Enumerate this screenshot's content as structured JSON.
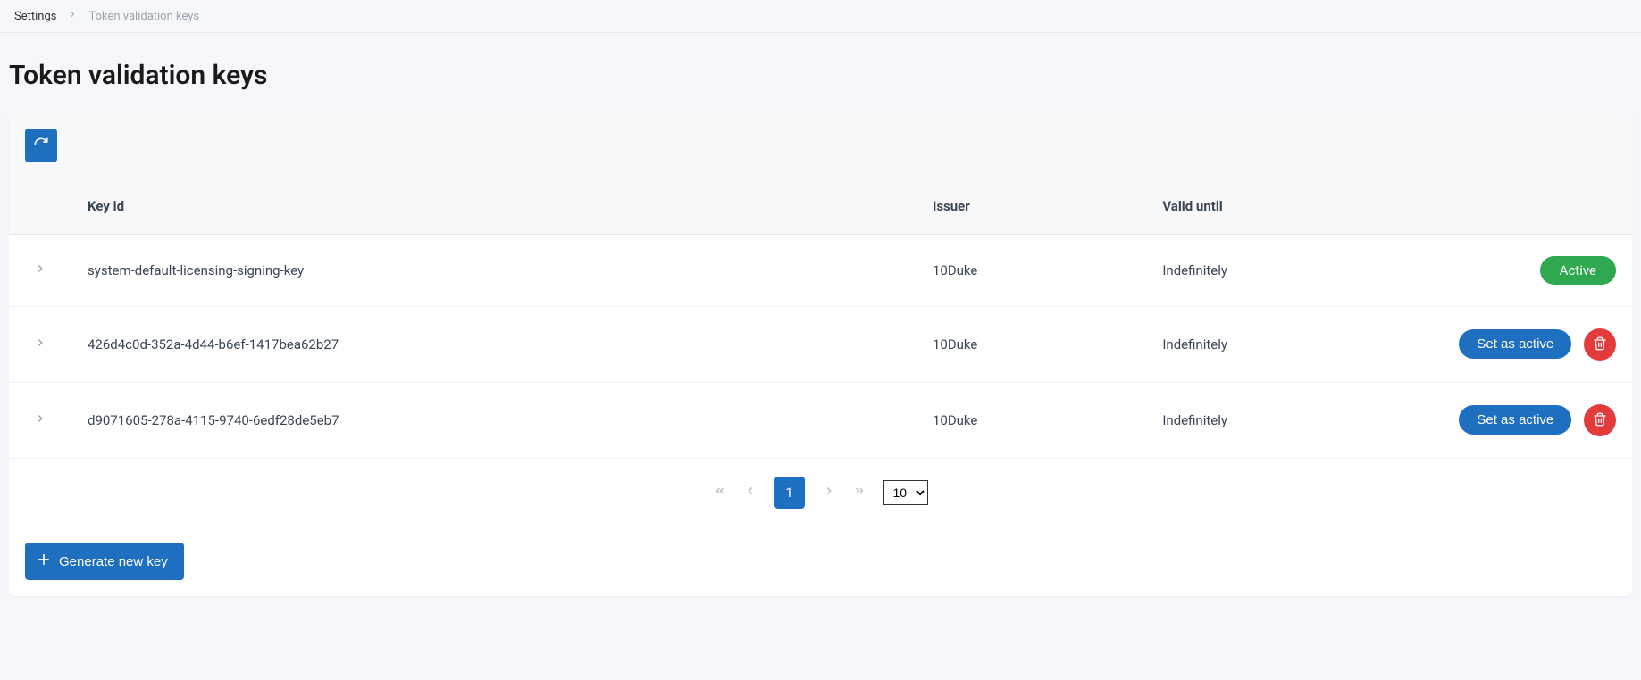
{
  "breadcrumb": {
    "root": "Settings",
    "current": "Token validation keys"
  },
  "page_title": "Token validation keys",
  "table": {
    "headers": {
      "key_id": "Key id",
      "issuer": "Issuer",
      "valid_until": "Valid until"
    },
    "rows": [
      {
        "key_id": "system-default-licensing-signing-key",
        "issuer": "10Duke",
        "valid_until": "Indefinitely",
        "status": "active"
      },
      {
        "key_id": "426d4c0d-352a-4d44-b6ef-1417bea62b27",
        "issuer": "10Duke",
        "valid_until": "Indefinitely",
        "status": "inactive"
      },
      {
        "key_id": "d9071605-278a-4115-9740-6edf28de5eb7",
        "issuer": "10Duke",
        "valid_until": "Indefinitely",
        "status": "inactive"
      }
    ]
  },
  "labels": {
    "active_badge": "Active",
    "set_as_active": "Set as active",
    "generate_new_key": "Generate new key"
  },
  "pagination": {
    "current_page": "1",
    "page_size": "10"
  }
}
